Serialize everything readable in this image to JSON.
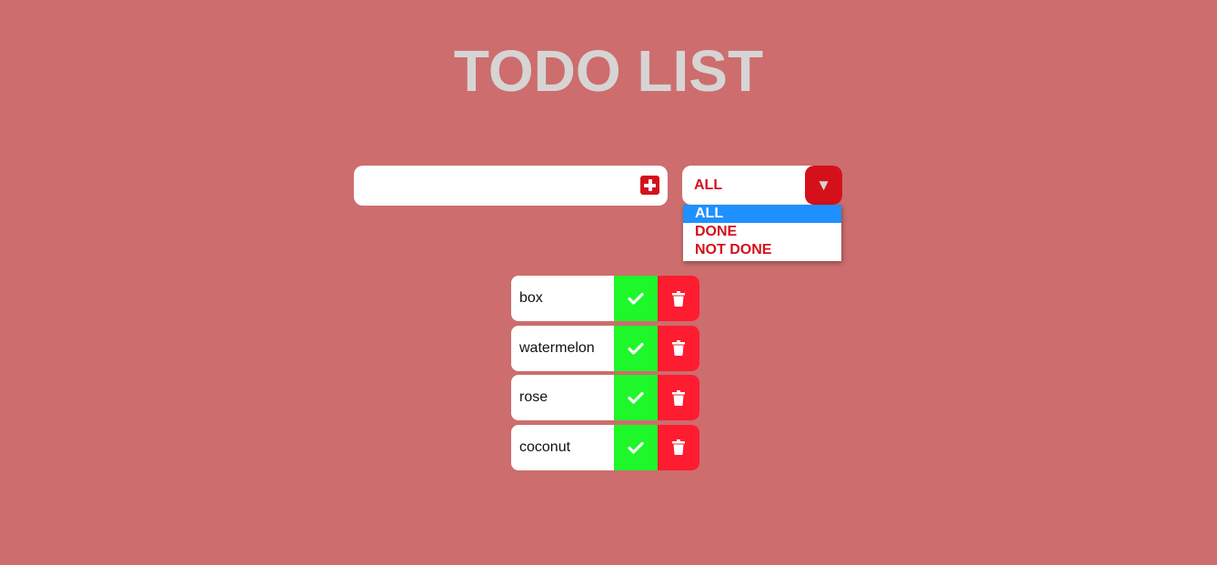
{
  "title": "TODO LIST",
  "input": {
    "value": "",
    "placeholder": "",
    "add_icon": "plus-square-icon"
  },
  "filter": {
    "selected": "ALL",
    "arrow_icon": "dropdown-arrow-icon",
    "arrow_glyph": "▼",
    "options": [
      "ALL",
      "DONE",
      "NOT DONE"
    ]
  },
  "todos": [
    {
      "text": "box"
    },
    {
      "text": "watermelon"
    },
    {
      "text": "rose"
    },
    {
      "text": "coconut"
    }
  ],
  "colors": {
    "background": "#cd6d6d",
    "title": "#d7d4d4",
    "accent": "#d4111b",
    "complete": "#1ef72a",
    "delete": "#fe1c30",
    "selected_option": "#1e90ff"
  }
}
